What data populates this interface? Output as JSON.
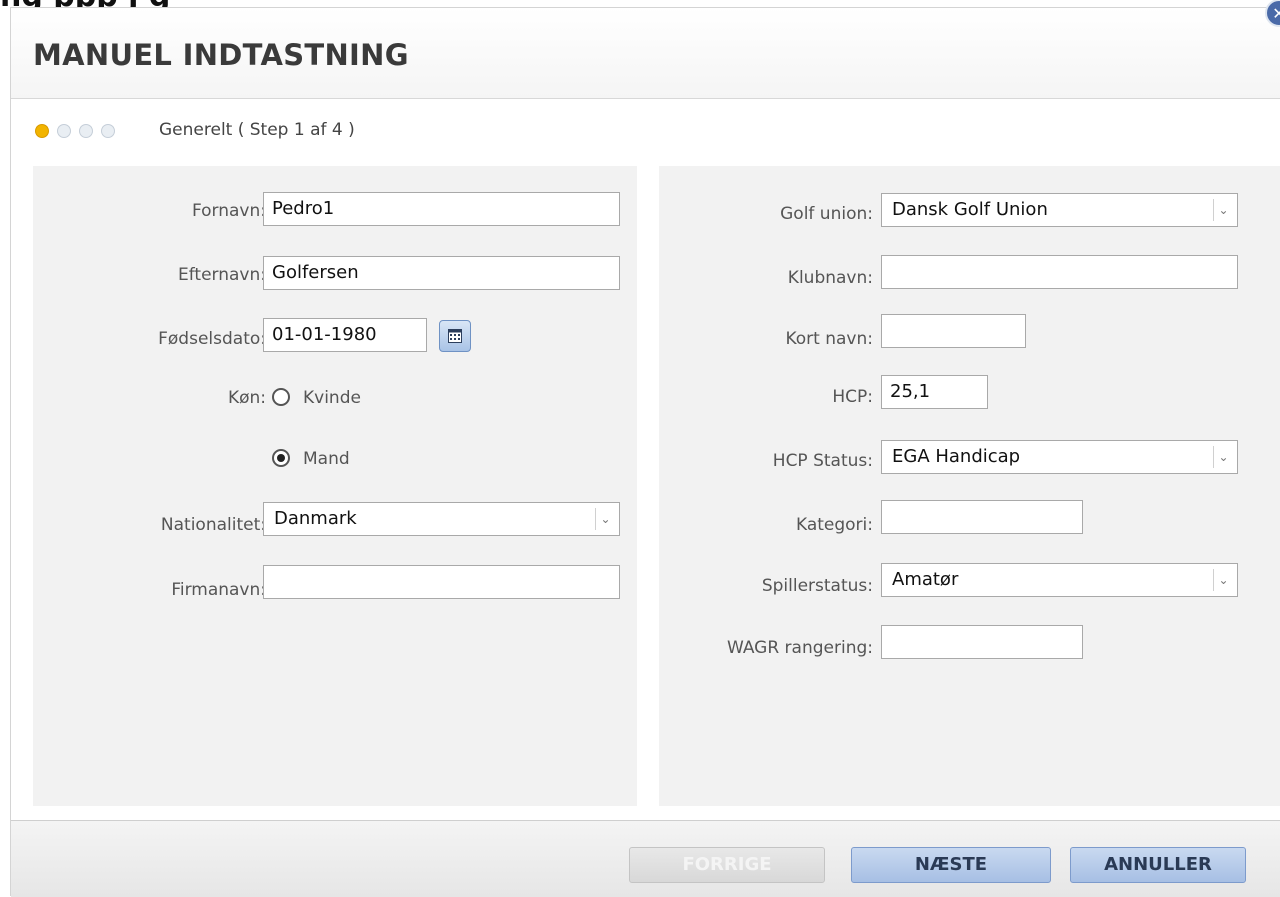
{
  "background_text": "ng           ppp                                                                          j           g",
  "dialog": {
    "title": "MANUEL INDTASTNING",
    "close_glyph": "✕",
    "steps": {
      "total": 4,
      "current": 1,
      "label": "Generelt ( Step 1 af 4 )"
    }
  },
  "left": {
    "fornavn": {
      "label": "Fornavn:",
      "value": "Pedro1"
    },
    "efternavn": {
      "label": "Efternavn:",
      "value": "Golfersen"
    },
    "fodselsdato": {
      "label": "Fødselsdato:",
      "value": "01-01-1980"
    },
    "kon": {
      "label": "Køn:",
      "options": [
        {
          "label": "Kvinde",
          "checked": false
        },
        {
          "label": "Mand",
          "checked": true
        }
      ]
    },
    "nationalitet": {
      "label": "Nationalitet:",
      "value": "Danmark"
    },
    "firmanavn": {
      "label": "Firmanavn:",
      "value": ""
    }
  },
  "right": {
    "golf_union": {
      "label": "Golf union:",
      "value": "Dansk Golf Union"
    },
    "klubnavn": {
      "label": "Klubnavn:",
      "value": ""
    },
    "kort_navn": {
      "label": "Kort navn:",
      "value": ""
    },
    "hcp": {
      "label": "HCP:",
      "value": "25,1"
    },
    "hcp_status": {
      "label": "HCP Status:",
      "value": "EGA Handicap"
    },
    "kategori": {
      "label": "Kategori:",
      "value": ""
    },
    "spillerstatus": {
      "label": "Spillerstatus:",
      "value": "Amatør"
    },
    "wagr": {
      "label": "WAGR rangering:",
      "value": ""
    }
  },
  "footer": {
    "prev_label": "FORRIGE",
    "next_label": "NÆSTE",
    "cancel_label": "ANNULLER"
  },
  "colors": {
    "active_step": "#f2b400",
    "primary_button": "#a7bfe4",
    "close_button": "#4a6aa8"
  },
  "icons": {
    "calendar": "calendar-icon",
    "dropdown": "chevron-down-icon",
    "close": "close-icon"
  }
}
